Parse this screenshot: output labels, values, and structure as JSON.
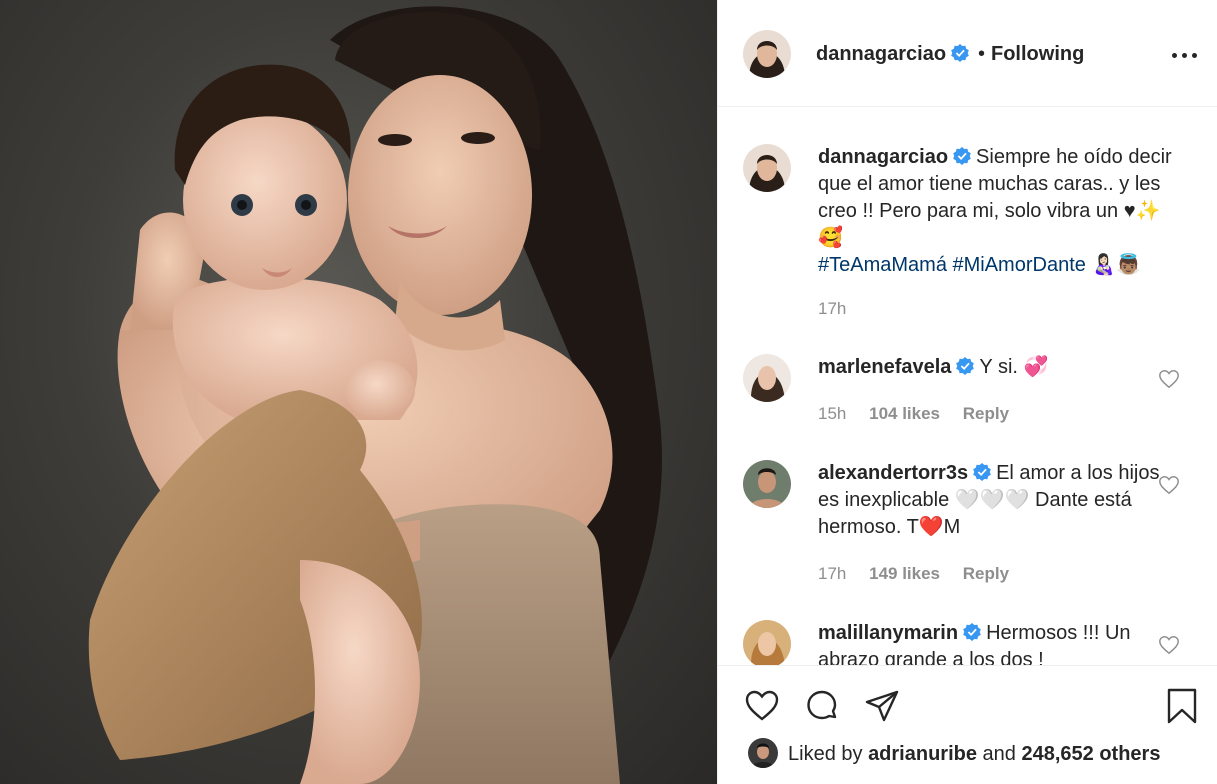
{
  "post": {
    "username": "dannagarciao",
    "dot": "•",
    "follow_status": "Following",
    "menu_icon": "more-icon"
  },
  "caption": {
    "username": "dannagarciao",
    "text": "Siempre he oído decir que el amor tiene muchas caras.. y les creo !! Pero para mi, solo vibra un ♥✨🥰",
    "hashtags": "#TeAmaMamá #MiAmorDante",
    "emoji_after_tags": "👩🏻‍🍼👼🏽",
    "time": "17h"
  },
  "comments": [
    {
      "username": "marlenefavela",
      "text": "Y si. 💞",
      "time": "15h",
      "likes": "104 likes",
      "reply": "Reply"
    },
    {
      "username": "alexandertorr3s",
      "text": "El amor a los hijos es inexplicable 🤍🤍🤍 Dante está hermoso. T❤️M",
      "time": "17h",
      "likes": "149 likes",
      "reply": "Reply"
    },
    {
      "username": "malillanymarin",
      "text": "Hermosos !!! Un abrazo grande a los dos !",
      "time": "",
      "likes": "",
      "reply": ""
    }
  ],
  "footer": {
    "liked_by_prefix": "Liked by",
    "liked_by_user": "adrianuribe",
    "liked_by_suffix": "and",
    "others": "248,652 others"
  },
  "colors": {
    "verified": "#3897f0",
    "text": "#262626",
    "meta": "#8e8e8e",
    "hashtag": "#00376b"
  }
}
